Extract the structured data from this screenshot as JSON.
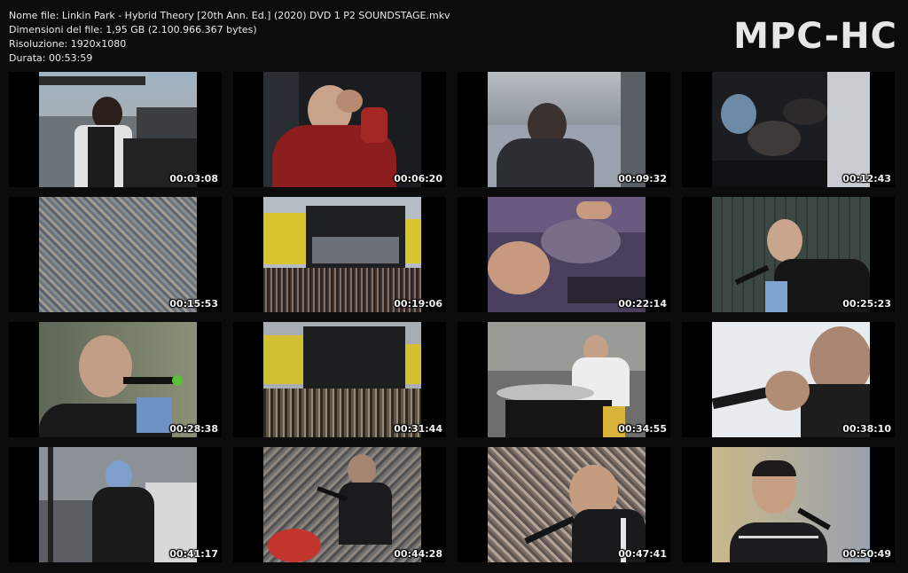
{
  "info": {
    "filename": "Nome file: Linkin Park - Hybrid Theory [20th Ann. Ed.] (2020) DVD 1 P2 SOUNDSTAGE.mkv",
    "filesize": "Dimensioni del file: 1,95 GB (2.100.966.367 bytes)",
    "resolution": "Risoluzione: 1920x1080",
    "duration": "Durata: 00:53:59"
  },
  "logo": "MPC-HC",
  "thumbnails": [
    {
      "time": "00:03:08",
      "scene": "dj-turntables-stage"
    },
    {
      "time": "00:06:20",
      "scene": "singer-red-hoodie"
    },
    {
      "time": "00:09:32",
      "scene": "blurry-performer"
    },
    {
      "time": "00:12:43",
      "scene": "drummer-dark-stage"
    },
    {
      "time": "00:15:53",
      "scene": "crowd-wide"
    },
    {
      "time": "00:19:06",
      "scene": "festival-stage-wide"
    },
    {
      "time": "00:22:14",
      "scene": "turntable-closeup"
    },
    {
      "time": "00:25:23",
      "scene": "singer-microphone"
    },
    {
      "time": "00:28:38",
      "scene": "singer-closeup"
    },
    {
      "time": "00:31:44",
      "scene": "festival-stage-crowd"
    },
    {
      "time": "00:34:55",
      "scene": "drummer-white-shirt"
    },
    {
      "time": "00:38:10",
      "scene": "rapper-microphone"
    },
    {
      "time": "00:41:17",
      "scene": "jumping-performer"
    },
    {
      "time": "00:44:28",
      "scene": "singer-over-crowd"
    },
    {
      "time": "00:47:41",
      "scene": "rapper-with-crowd"
    },
    {
      "time": "00:50:49",
      "scene": "rapper-track-jacket"
    }
  ]
}
